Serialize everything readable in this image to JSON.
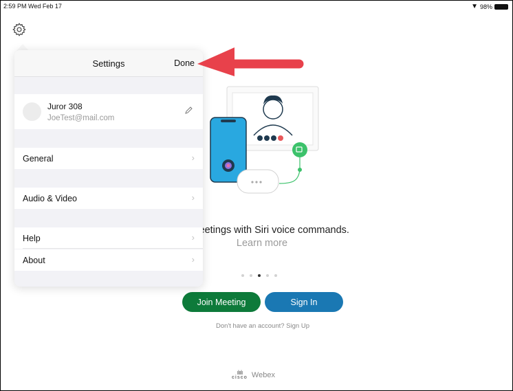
{
  "status_bar": {
    "time_date": "2:59 PM  Wed Feb 17",
    "battery": "98%"
  },
  "settings": {
    "title": "Settings",
    "done_label": "Done",
    "account": {
      "name": "Juror 308",
      "email": "JoeTest@mail.com"
    },
    "items": [
      {
        "label": "General"
      },
      {
        "label": "Audio & Video"
      },
      {
        "label": "Help"
      },
      {
        "label": "About"
      }
    ]
  },
  "promo": {
    "text": "oin meetings with Siri voice commands.",
    "link": "Learn more",
    "page_count": 5,
    "active_page": 3
  },
  "actions": {
    "join_label": "Join Meeting",
    "signin_label": "Sign In",
    "signup_text": "Don't have an account? Sign Up"
  },
  "branding": {
    "logo_text": "cisco",
    "product": "Webex"
  },
  "colors": {
    "join": "#0d7a3a",
    "signin": "#1a78b3",
    "annotation_arrow": "#e8414b",
    "video_accent": "#3cc26b",
    "phone": "#29a8e0"
  },
  "icons": {
    "gear": "gear-icon",
    "pencil": "pencil-icon",
    "chevron": "chevron-right-icon",
    "siri": "siri-icon"
  }
}
